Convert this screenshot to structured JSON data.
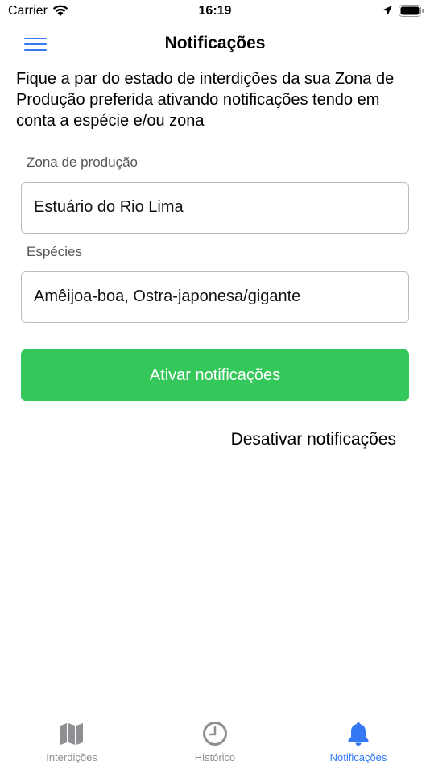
{
  "status_bar": {
    "carrier": "Carrier",
    "time": "16:19"
  },
  "nav": {
    "title": "Notificações",
    "menu_icon": "hamburger-menu-icon"
  },
  "description": "Fique a par do estado de interdições da sua Zona de Produção preferida ativando notificações tendo em conta a espécie e/ou zona",
  "form": {
    "zone_label": "Zona de produção",
    "zone_value": "Estuário do Rio Lima",
    "species_label": "Espécies",
    "species_value": "Amêijoa-boa, Ostra-japonesa/gigante"
  },
  "actions": {
    "activate_label": "Ativar notificações",
    "deactivate_label": "Desativar notificações"
  },
  "tabs": [
    {
      "label": "Interdições",
      "icon": "map-icon",
      "active": false
    },
    {
      "label": "Histórico",
      "icon": "clock-icon",
      "active": false
    },
    {
      "label": "Notificações",
      "icon": "bell-icon",
      "active": true
    }
  ],
  "colors": {
    "accent": "#3478f6",
    "success": "#34c759",
    "inactive": "#8e8e93"
  }
}
